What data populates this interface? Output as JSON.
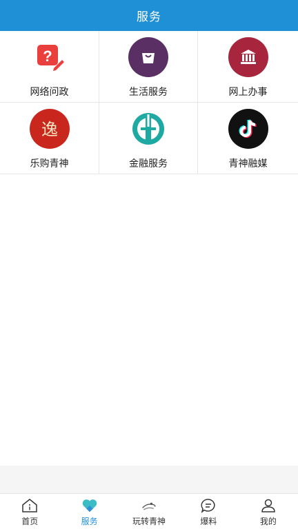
{
  "header": {
    "title": "服务"
  },
  "services": [
    {
      "label": "网络问政",
      "icon": "question-edit-icon",
      "color": "#e9403e"
    },
    {
      "label": "生活服务",
      "icon": "shopping-bag-icon",
      "color": "#5a2f63"
    },
    {
      "label": "网上办事",
      "icon": "government-building-icon",
      "color": "#a7263d"
    },
    {
      "label": "乐购青神",
      "icon": "yi-logo-icon",
      "color": "#c9261d"
    },
    {
      "label": "金融服务",
      "icon": "abc-bank-icon",
      "color": "#1fa9a3"
    },
    {
      "label": "青神融媒",
      "icon": "tiktok-icon",
      "color": "#111111"
    }
  ],
  "tabbar": {
    "items": [
      {
        "label": "首页",
        "icon": "home-icon",
        "active": false
      },
      {
        "label": "服务",
        "icon": "heart-icon",
        "active": true
      },
      {
        "label": "玩转青神",
        "icon": "landmark-icon",
        "active": false
      },
      {
        "label": "爆料",
        "icon": "chat-bubble-icon",
        "active": false
      },
      {
        "label": "我的",
        "icon": "person-icon",
        "active": false
      }
    ],
    "active_color": "#1f8fd6"
  }
}
